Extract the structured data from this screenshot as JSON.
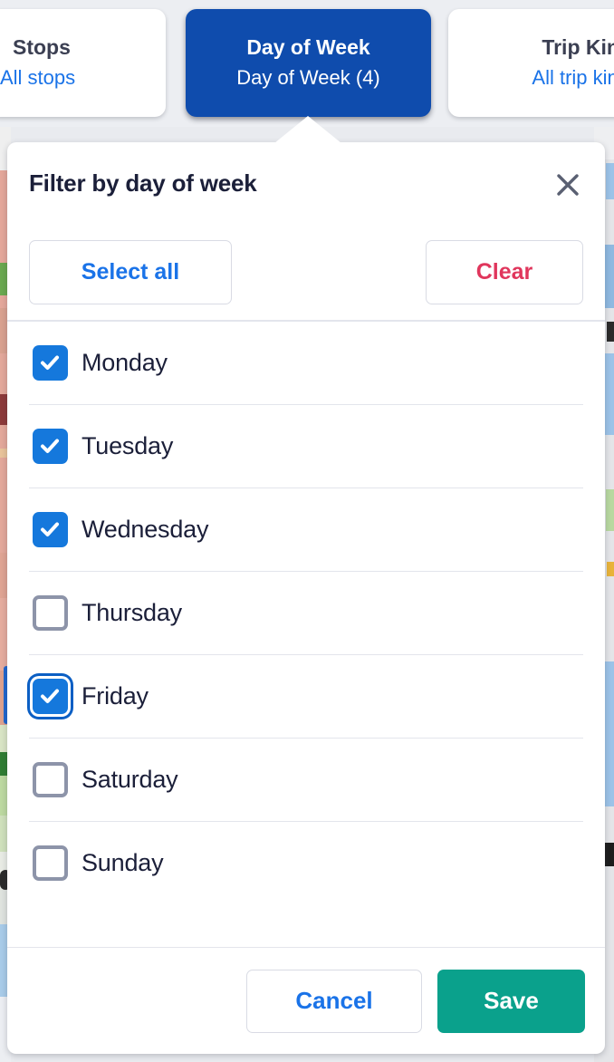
{
  "filter_bar": {
    "cards": [
      {
        "title": "Stops",
        "value": "All stops",
        "active": false,
        "name": "filter-card-stops"
      },
      {
        "title": "Day of Week",
        "value": "Day of Week (4)",
        "active": true,
        "name": "filter-card-day-of-week"
      },
      {
        "title": "Trip Kind",
        "value": "All trip kinds",
        "active": false,
        "name": "filter-card-trip-kind"
      }
    ]
  },
  "popup": {
    "title": "Filter by day of week",
    "close_icon": "close-icon",
    "bulk": {
      "select_all_label": "Select all",
      "clear_label": "Clear"
    },
    "days": [
      {
        "label": "Monday",
        "checked": true,
        "focused": false
      },
      {
        "label": "Tuesday",
        "checked": true,
        "focused": false
      },
      {
        "label": "Wednesday",
        "checked": true,
        "focused": false
      },
      {
        "label": "Thursday",
        "checked": false,
        "focused": false
      },
      {
        "label": "Friday",
        "checked": true,
        "focused": true
      },
      {
        "label": "Saturday",
        "checked": false,
        "focused": false
      },
      {
        "label": "Sunday",
        "checked": false,
        "focused": false
      }
    ],
    "footer": {
      "cancel_label": "Cancel",
      "save_label": "Save"
    }
  },
  "colors": {
    "accent_blue": "#1a73e8",
    "active_card_blue": "#0f4cad",
    "checkbox_blue": "#1578dc",
    "clear_red": "#e0365c",
    "save_teal": "#0aa18c",
    "text_dark": "#1b1f39",
    "divider": "#e3e5ec",
    "page_background": "#eceef2"
  }
}
